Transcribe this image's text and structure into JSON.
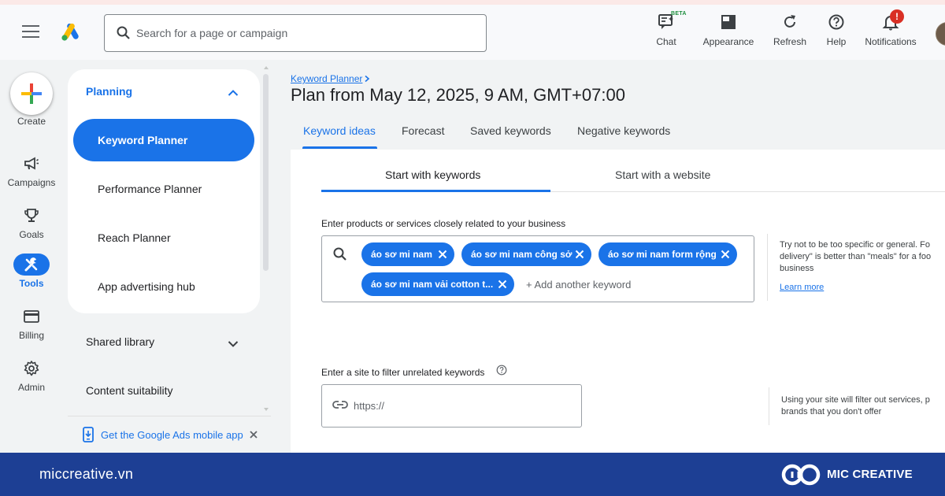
{
  "header": {
    "search_placeholder": "Search for a page or campaign",
    "beta_label": "BETA",
    "notification_badge": "!",
    "actions": [
      {
        "label": "Chat",
        "icon": "chat-icon"
      },
      {
        "label": "Appearance",
        "icon": "appearance-icon"
      },
      {
        "label": "Refresh",
        "icon": "refresh-icon"
      },
      {
        "label": "Help",
        "icon": "help-icon"
      },
      {
        "label": "Notifications",
        "icon": "bell-icon"
      }
    ]
  },
  "rail": {
    "create_label": "Create",
    "items": [
      {
        "label": "Campaigns",
        "icon": "megaphone-icon"
      },
      {
        "label": "Goals",
        "icon": "trophy-icon"
      },
      {
        "label": "Tools",
        "icon": "tools-icon",
        "active": true
      },
      {
        "label": "Billing",
        "icon": "credit-card-icon"
      },
      {
        "label": "Admin",
        "icon": "gear-icon"
      }
    ]
  },
  "nav": {
    "planning_label": "Planning",
    "items": [
      "Keyword Planner",
      "Performance Planner",
      "Reach Planner",
      "App advertising hub"
    ],
    "active_item": "Keyword Planner",
    "shared_library_label": "Shared library",
    "content_suitability_label": "Content suitability",
    "mobile_app_label": "Get the Google Ads mobile app"
  },
  "main": {
    "breadcrumb": "Keyword Planner",
    "title": "Plan from May 12, 2025, 9 AM, GMT+07:00",
    "tabs": [
      "Keyword ideas",
      "Forecast",
      "Saved keywords",
      "Negative keywords"
    ],
    "active_tab": "Keyword ideas",
    "subtabs": [
      "Start with keywords",
      "Start with a website"
    ],
    "active_subtab": "Start with keywords",
    "keywords_label": "Enter products or services closely related to your business",
    "keywords": [
      "áo sơ mi nam",
      "áo sơ mi nam công sở",
      "áo sơ mi nam form rộng",
      "áo sơ mi nam vải cotton t..."
    ],
    "add_keyword_placeholder": "+ Add another keyword",
    "keyword_hint": "Try not to be too specific or general. Fo delivery\" is better than \"meals\" for a foo business",
    "keyword_hint_lines": [
      "Try not to be too specific or general. Fo",
      "delivery\" is better than \"meals\" for a foo",
      "business"
    ],
    "learn_more": "Learn more",
    "site_label": "Enter a site to filter unrelated keywords",
    "site_placeholder": "https://",
    "site_hint_lines": [
      "Using your site will filter out services, p",
      "brands that you don't offer"
    ]
  },
  "banner": {
    "url": "miccreative.vn",
    "brand": "MIC CREATIVE"
  },
  "colors": {
    "accent": "#1a73e8",
    "banner": "#1d3f94",
    "badge": "#d93025"
  }
}
